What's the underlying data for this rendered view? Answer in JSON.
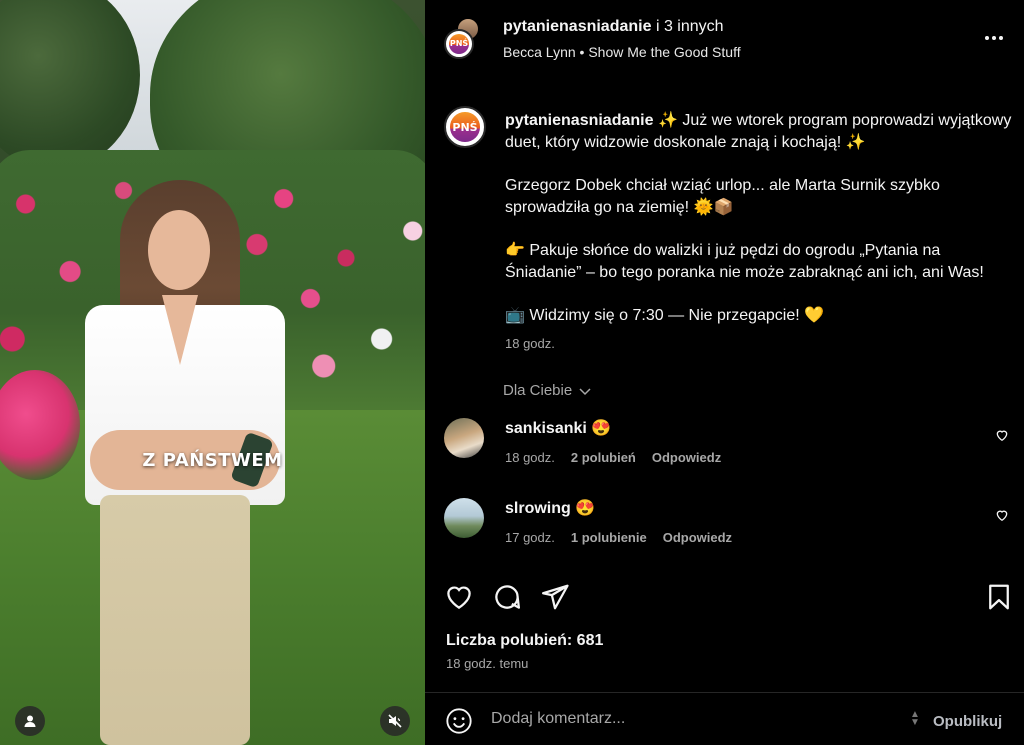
{
  "media": {
    "overlay_text": "Z PAŃSTWEM",
    "user_icon": "person-icon",
    "mute_icon": "speaker-muted-icon"
  },
  "header": {
    "title_user": "pytanienasniadanie",
    "title_rest": " i 3 innych",
    "subtitle": "Becca Lynn • Show Me the Good Stuff",
    "logo_text": "PNŚ"
  },
  "caption": {
    "username": "pytanienasniadanie",
    "para1": " ✨ Już we wtorek program poprowadzi wyjątkowy duet, który widzowie doskonale znają i kochają! ✨",
    "para2": "Grzegorz Dobek chciał wziąć urlop... ale Marta Surnik szybko sprowadziła go na ziemię! 🌞📦",
    "para3": "👉 Pakuje słońce do walizki i już pędzi do ogrodu „Pytania na Śniadanie” – bo tego poranka nie może zabraknąć ani ich, ani Was!",
    "para4": "📺 Widzimy się o 7:30 — Nie przegapcie! 💛",
    "time": "18 godz."
  },
  "for_you": "Dla Ciebie",
  "comments": [
    {
      "user": "sankisanki",
      "emoji": "😍",
      "time": "18 godz.",
      "likes": "2 polubień",
      "reply": "Odpowiedz"
    },
    {
      "user": "slrowing",
      "emoji": "😍",
      "time": "17 godz.",
      "likes": "1 polubienie",
      "reply": "Odpowiedz"
    }
  ],
  "likes_text": "Liczba polubień: 681",
  "ago_text": "18 godz. temu",
  "add_comment": {
    "placeholder": "Dodaj komentarz...",
    "publish": "Opublikuj"
  },
  "colors": {
    "background": "#000000",
    "muted_text": "#a8a8a8",
    "primary_text": "#f5f5f5"
  }
}
